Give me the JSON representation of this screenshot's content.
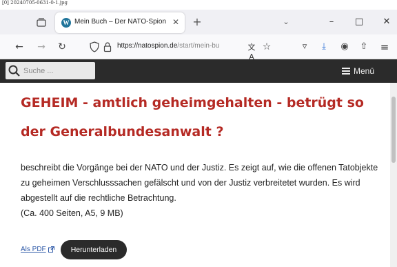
{
  "caption": "[0] 20240705-0631-0-1.jpg",
  "browser": {
    "tab": {
      "title": "Mein Buch – Der NATO-Spion l…",
      "favicon": "W"
    },
    "new_tab_label": "+",
    "url": {
      "host": "https://natospion.de",
      "path": "/start/mein-bu"
    },
    "icons": {
      "tab_list": "tab-list-icon",
      "back": "←",
      "forward": "→",
      "reload": "↻",
      "translate": "文A",
      "bookmark": "☆",
      "dropdown": "⌄",
      "minimize": "–",
      "maximize": "□",
      "close": "✕",
      "tab_close": "✕",
      "pocket": "▿",
      "download": "⤓",
      "account": "◉",
      "share": "⇧",
      "menu": "≡"
    }
  },
  "site": {
    "search_placeholder": "Suche ...",
    "menu_label": "Menü"
  },
  "article": {
    "headline": "GEHEIM - amtlich geheimgehalten - betrügt so der Generalbundesanwalt ?",
    "description": "beschreibt die Vorgänge bei der NATO und der Justiz. Es zeigt auf, wie die offenen Tatobjekte zu geheimen Verschlusssachen gefälscht und von der Justiz verbreitetet wurden. Es wird abgestellt auf die rechtliche Betrachtung.",
    "meta": "(Ca. 400 Seiten, A5, 9 MB)",
    "pdf_link": "Als PDF",
    "download_button": "Herunterladen"
  },
  "colors": {
    "headline": "#b52a24",
    "header_bg": "#2b2b2b",
    "link": "#2f5aa8"
  }
}
